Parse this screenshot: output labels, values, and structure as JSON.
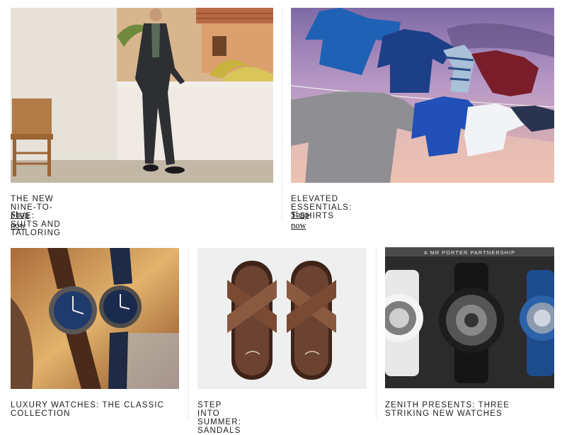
{
  "feature_cards": [
    {
      "title": "THE NEW NINE-TO-FIVE: SUITS AND TAILORING",
      "link_label": "Shop now",
      "image": "man-in-suit-terrace-photo"
    },
    {
      "title": "ELEVATED ESSENTIALS: T-SHIRTS",
      "link_label": "Shop now",
      "image": "t-shirts-on-clothesline-photo"
    }
  ],
  "story_cards": [
    {
      "title": "LUXURY WATCHES: THE CLASSIC COLLECTION",
      "image": "pilot-watches-photo"
    },
    {
      "title": "STEP INTO SUMMER: SANDALS",
      "image": "leather-sandals-photo"
    },
    {
      "title": "ZENITH PRESENTS: THREE STRIKING NEW WATCHES",
      "image": "zenith-watches-photo",
      "banner": "A MR PORTER PARTNERSHIP"
    }
  ],
  "colors": {
    "text": "#1c1c1c",
    "link": "#111111",
    "divider": "#d8d8d8"
  }
}
